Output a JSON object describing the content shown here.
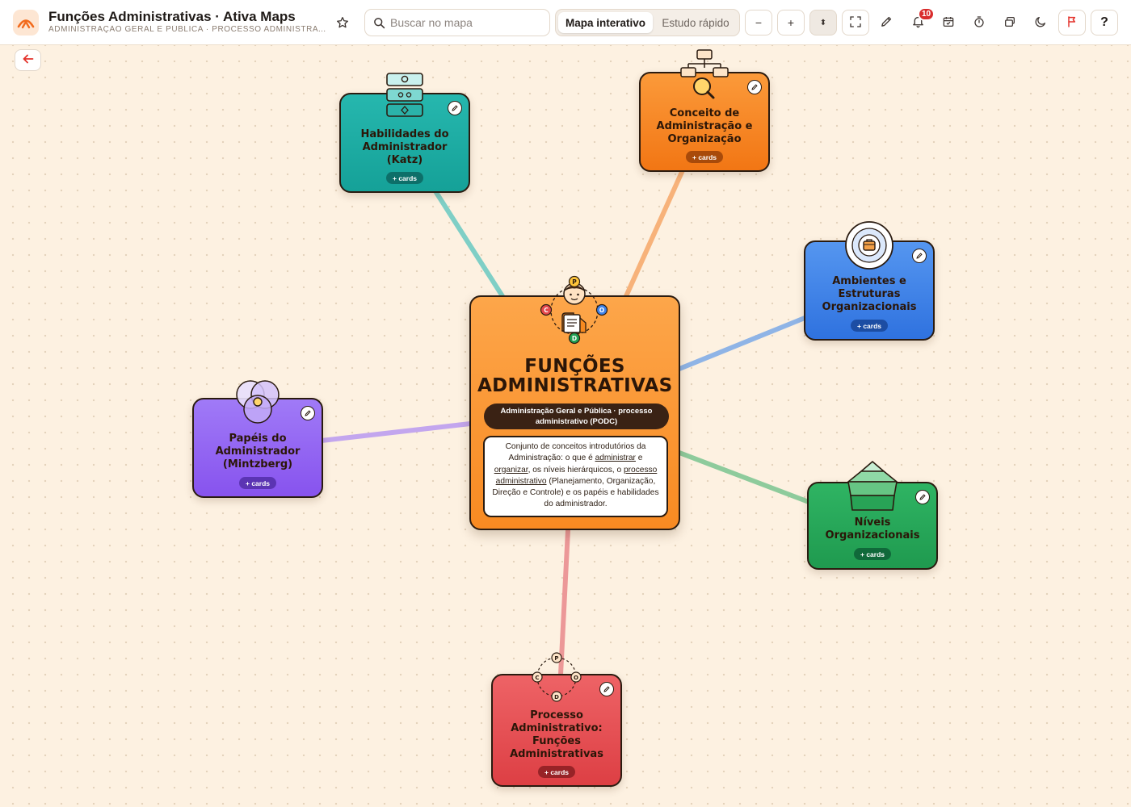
{
  "app": {
    "title": "Funções Administrativas · Ativa Maps",
    "subtitle": "ADMINISTRAÇÃO GERAL E PÚBLICA · PROCESSO ADMINISTRATIVO (PODC)",
    "logo_icon": "ativa-maps-logo-icon",
    "brand_color": "#f26b1d"
  },
  "toolbar": {
    "search_placeholder": "Buscar no mapa",
    "search_value": "",
    "modes": [
      "Mapa interativo",
      "Estudo rápido"
    ],
    "active_mode": "Mapa interativo",
    "zoom_out_label": "−",
    "zoom_in_label": "+",
    "zoom_reset_label": "⬍",
    "notifications_count": "10",
    "help_label": "?",
    "icons": [
      "star-icon",
      "search-icon",
      "fullscreen-icon",
      "pencil-icon",
      "bell-icon",
      "calendar-icon",
      "timer-icon",
      "layers-icon",
      "moon-icon",
      "flag-icon",
      "back-arrow-icon"
    ]
  },
  "central": {
    "title": "FUNÇÕES ADMINISTRATIVAS",
    "subtitle": "Administração Geral e Pública · processo administrativo (PODC)",
    "desc_1": "Conjunto de conceitos introdutórios da Administração: o que é ",
    "desc_link_1": "administrar",
    "desc_2": " e ",
    "desc_link_2": "organizar",
    "desc_3": ", os níveis hierárquicos, o ",
    "desc_link_3": "processo administrativo",
    "desc_4": " (Planejamento, Organização, Direção e Controle) e os papéis e habilidades do administrador.",
    "podc_letters": [
      "P",
      "O",
      "D",
      "C"
    ],
    "color": "#f88a22"
  },
  "nodes": {
    "katz": {
      "title": "Habilidades do Administrador (Katz)",
      "cards": "+ cards",
      "color": "#1aaaa2",
      "icon": "skills-stack-icon"
    },
    "conceito": {
      "title": "Conceito de Administração e Organização",
      "cards": "+ cards",
      "color": "#f47f1c",
      "icon": "org-chart-magnifier-icon"
    },
    "ambientes": {
      "title": "Ambientes e Estruturas Organizacionais",
      "cards": "+ cards",
      "color": "#3f82e8",
      "icon": "target-briefcase-icon"
    },
    "mintzberg": {
      "title": "Papéis do Administrador (Mintzberg)",
      "cards": "+ cards",
      "color": "#8a5cf0",
      "icon": "venn-circles-icon"
    },
    "niveis": {
      "title": "Níveis Organizacionais",
      "cards": "+ cards",
      "color": "#23a054",
      "icon": "pyramid-levels-icon"
    },
    "processo": {
      "title": "Processo Administrativo: Funções Administrativas",
      "cards": "+ cards",
      "color": "#e4484c",
      "icon": "podc-cycle-icon",
      "letters": [
        "P",
        "O",
        "D",
        "C"
      ]
    }
  },
  "link_colors": {
    "katz": "#7fcfc6",
    "conceito": "#f7b27a",
    "ambientes": "#8fb4e6",
    "mintzberg": "#c3a6ee",
    "niveis": "#8ecb9c",
    "processo": "#ec9898"
  }
}
